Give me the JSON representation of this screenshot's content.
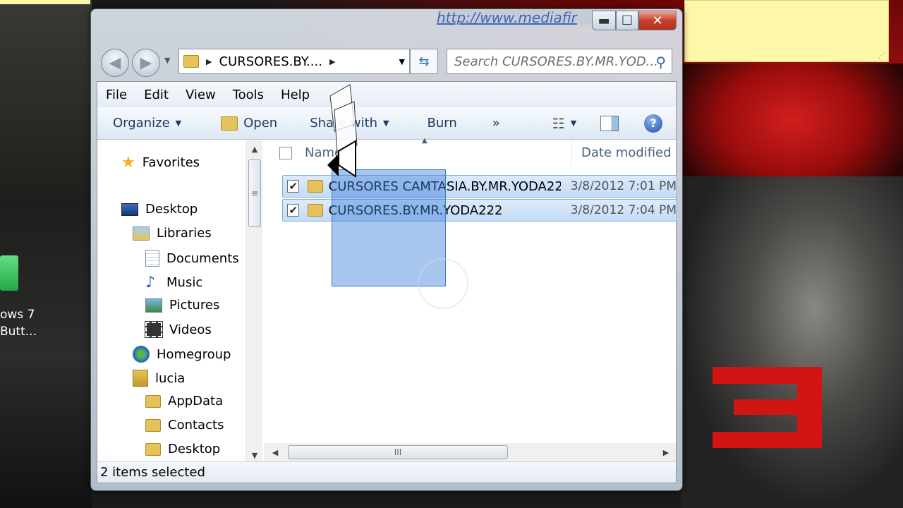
{
  "window": {
    "minimize_glyph": "▬",
    "maximize_glyph": "☐",
    "close_glyph": "✕",
    "url_fragment": "http://www.mediafir"
  },
  "desktop": {
    "left_label_1": "ows 7",
    "left_label_2": "Butt..."
  },
  "address_bar": {
    "path": "CURSORES.BY....",
    "search_placeholder": "Search CURSORES.BY.MR.YOD..."
  },
  "menu": {
    "items": [
      "File",
      "Edit",
      "View",
      "Tools",
      "Help"
    ]
  },
  "toolbar": {
    "organize": "Organize",
    "open": "Open",
    "share_with": "Share with",
    "burn": "Burn",
    "more": "»",
    "help": "?"
  },
  "nav_pane": {
    "items": [
      "Favorites",
      "Desktop",
      "Libraries",
      "Documents",
      "Music",
      "Pictures",
      "Videos",
      "Homegroup",
      "lucia",
      "AppData",
      "Contacts",
      "Desktop"
    ]
  },
  "columns": {
    "name": "Name",
    "date_modified": "Date modified"
  },
  "files": [
    {
      "name": "CURSORES CAMTASIA.BY.MR.YODA222",
      "date": "3/8/2012 7:01 PM",
      "checked": true
    },
    {
      "name": "CURSORES.BY.MR.YODA222",
      "date": "3/8/2012 7:04 PM",
      "checked": true
    }
  ],
  "scroll": {
    "grip": "III",
    "v_grip": "≡"
  },
  "status": "2 items selected"
}
